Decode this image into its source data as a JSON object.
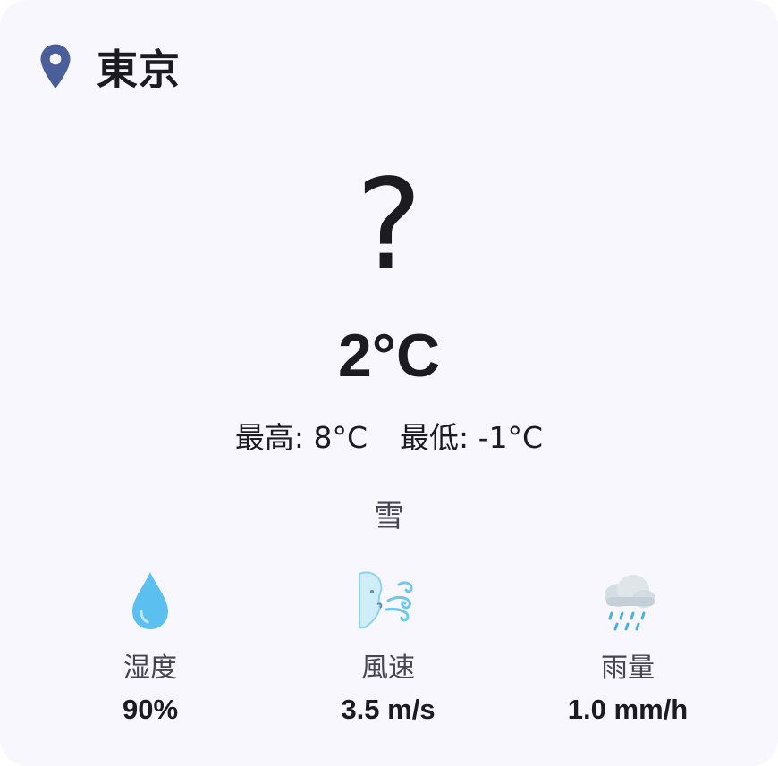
{
  "weather_card": {
    "location_icon": "map-pin-icon",
    "city": "東京",
    "condition_icon": "?",
    "temperature": "2°C",
    "high": "最高: 8°C",
    "low": "最低: -1°C",
    "description": "雪",
    "stats": [
      {
        "icon": "droplet-icon",
        "label": "湿度",
        "value": "90%"
      },
      {
        "icon": "wind-face-icon",
        "label": "風速",
        "value": "3.5 m/s"
      },
      {
        "icon": "rain-cloud-icon",
        "label": "雨量",
        "value": "1.0 mm/h"
      }
    ],
    "colors": {
      "card_background": "#f8f7fd",
      "pin": "#4a5f9a",
      "text_primary": "#1c1b1f",
      "text_secondary": "#46464f",
      "droplet": "#5bc0f0"
    }
  }
}
